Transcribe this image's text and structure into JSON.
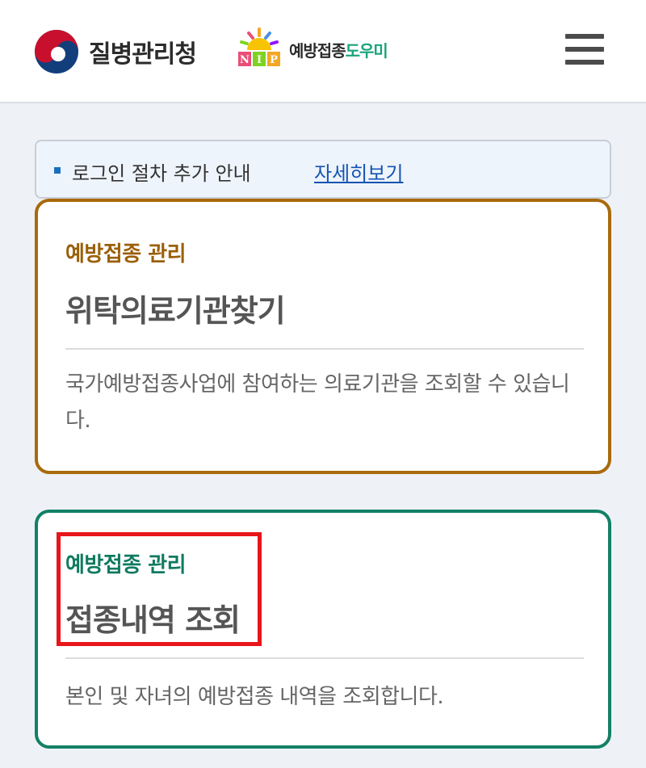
{
  "header": {
    "agency_name": "질병관리청",
    "nip_badge": "NIP",
    "service_name_main": "예방접종",
    "service_name_accent": "도우미",
    "menu_icon": "hamburger-menu-icon",
    "colors": {
      "agency_red": "#c8102e",
      "agency_blue": "#123e7c",
      "service_accent": "#1aa37a"
    }
  },
  "notice": {
    "text": "로그인 절차 추가 안내",
    "link_label": "자세히보기"
  },
  "cards": [
    {
      "category": "예방접종 관리",
      "title": "위탁의료기관찾기",
      "description": "국가예방접종사업에 참여하는 의료기관을 조회할 수 있습니다.",
      "accent_color": "#a86a0c"
    },
    {
      "category": "예방접종 관리",
      "title": "접종내역 조회",
      "description": "본인 및 자녀의 예방접종 내역을 조회합니다.",
      "accent_color": "#138066"
    }
  ],
  "highlight": {
    "color": "#e8151b"
  }
}
